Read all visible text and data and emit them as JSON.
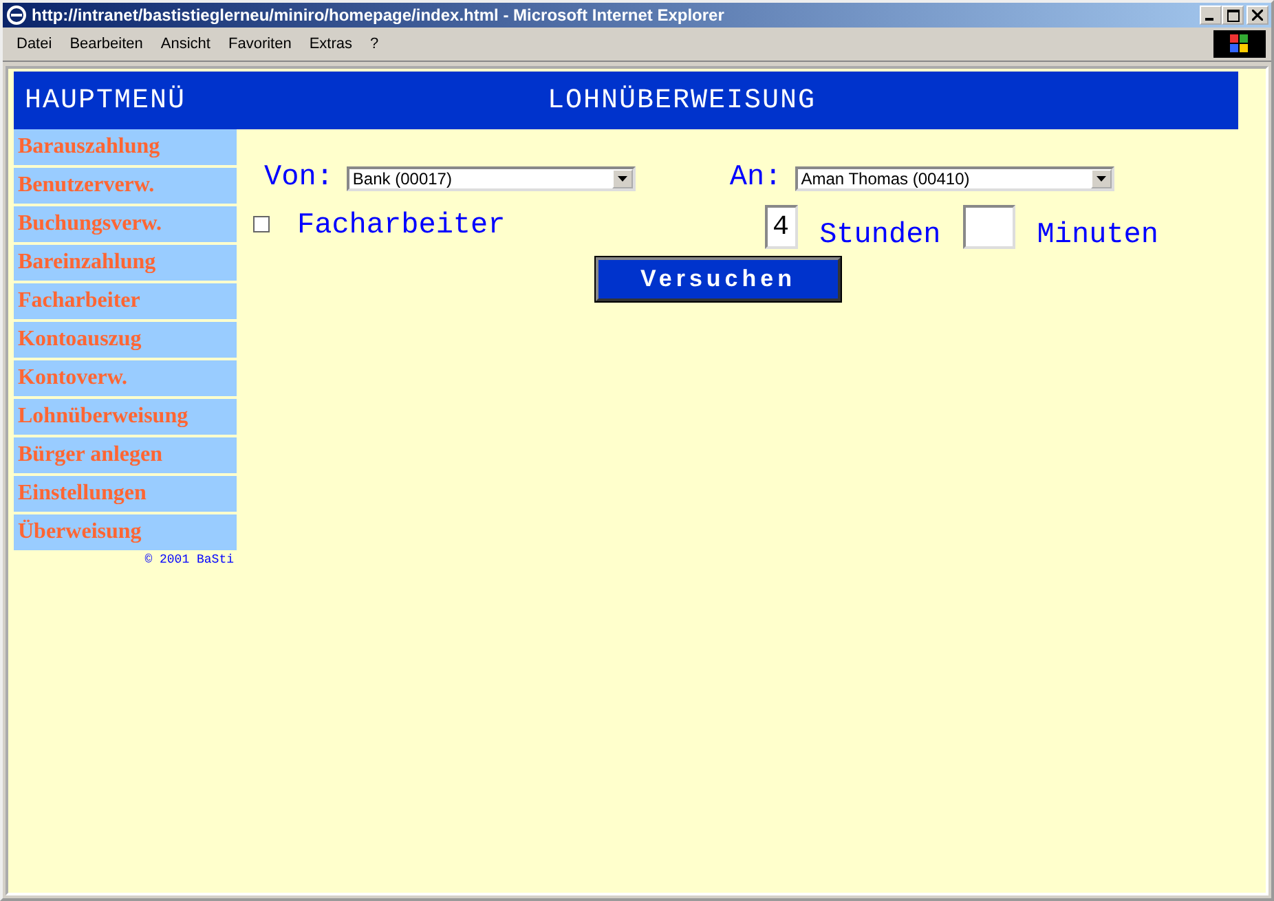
{
  "window": {
    "title": "http://intranet/bastistieglerneu/miniro/homepage/index.html - Microsoft Internet Explorer"
  },
  "menu": [
    "Datei",
    "Bearbeiten",
    "Ansicht",
    "Favoriten",
    "Extras",
    "?"
  ],
  "header": {
    "menu_title": "HAUPTMENÜ",
    "page_title": "LOHNÜBERWEISUNG"
  },
  "sidebar": {
    "items": [
      {
        "label": "Barauszahlung"
      },
      {
        "label": "Benutzerverw."
      },
      {
        "label": "Buchungsverw."
      },
      {
        "label": "Bareinzahlung"
      },
      {
        "label": "Facharbeiter"
      },
      {
        "label": "Kontoauszug"
      },
      {
        "label": "Kontoverw."
      },
      {
        "label": "Lohnüberweisung"
      },
      {
        "label": "Bürger anlegen"
      },
      {
        "label": "Einstellungen"
      },
      {
        "label": "Überweisung"
      }
    ],
    "copyright": "© 2001 BaSti"
  },
  "form": {
    "from_label": "Von:",
    "from_value": "Bank (00017)",
    "to_label": "An:",
    "to_value": "Aman Thomas (00410)",
    "checkbox": {
      "label": "Facharbeiter",
      "checked": false
    },
    "hours": "4",
    "hours_label": "Stunden",
    "minutes_label": "Minuten",
    "submit": "Versuchen"
  }
}
